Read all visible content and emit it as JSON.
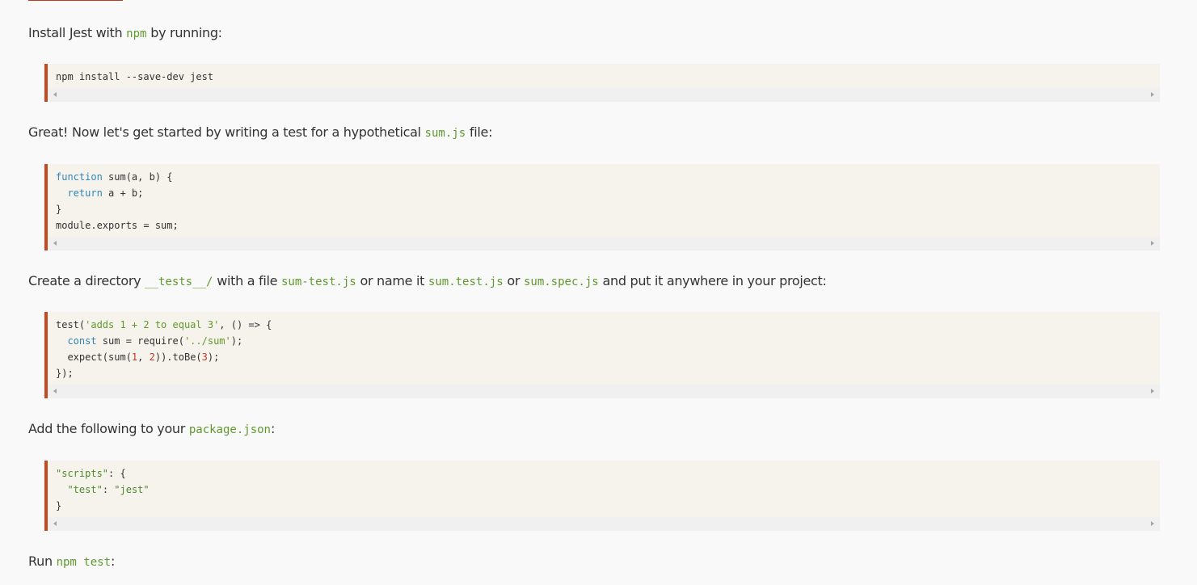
{
  "paragraphs": {
    "install": {
      "before": "Install Jest with ",
      "code": "npm",
      "after": " by running:"
    },
    "great": {
      "before": "Great! Now let's get started by writing a test for a hypothetical ",
      "code": "sum.js",
      "after": " file:"
    },
    "create": {
      "t1": "Create a directory ",
      "c1": "__tests__/",
      "t2": " with a file ",
      "c2": "sum-test.js",
      "t3": " or name it ",
      "c3": "sum.test.js",
      "t4": " or ",
      "c4": "sum.spec.js",
      "t5": " and put it anywhere in your project:"
    },
    "add": {
      "before": "Add the following to your ",
      "code": "package.json",
      "after": ":"
    },
    "run": {
      "before": "Run ",
      "code": "npm test",
      "after": ":"
    }
  },
  "code_blocks": {
    "install": {
      "l1": "npm install --save-dev jest"
    },
    "sum": {
      "l1_kw": "function",
      "l1_rest": " sum(a, b) {",
      "l2_indent": "  ",
      "l2_kw": "return",
      "l2_rest": " a + b;",
      "l3": "}",
      "l4": "module.exports = sum;"
    },
    "test": {
      "l1_a": "test(",
      "l1_str": "'adds 1 + 2 to equal 3'",
      "l1_b": ", () => {",
      "l2_indent": "  ",
      "l2_kw": "const",
      "l2_a": " sum = require(",
      "l2_str": "'../sum'",
      "l2_b": ");",
      "l3_a": "  expect(sum(",
      "l3_n1": "1",
      "l3_b": ", ",
      "l3_n2": "2",
      "l3_c": ")).toBe(",
      "l3_n3": "3",
      "l3_d": ");",
      "l4": "});"
    },
    "pkg": {
      "l1_str": "\"scripts\"",
      "l1_rest": ": {",
      "l2_indent": "  ",
      "l2_key": "\"test\"",
      "l2_sep": ": ",
      "l2_val": "\"jest\"",
      "l3": "}"
    }
  },
  "colors": {
    "keyword": "#2f86b8",
    "string": "#5e9a2c",
    "number": "#c0392b",
    "inline_code": "#5f9a2e",
    "block_border": "#c6491f",
    "block_background": "#f6f2ec"
  },
  "icons": {
    "scroll_left": "scroll-left-arrow-icon",
    "scroll_right": "scroll-right-arrow-icon"
  }
}
